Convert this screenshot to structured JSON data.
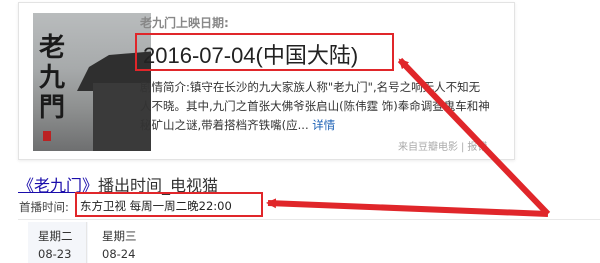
{
  "movie_card": {
    "poster_calligraphy": "老九門",
    "release_label": "老九门上映日期:",
    "release_value": "2016-07-04(中国大陆)",
    "synopsis": "剧情简介:镇守在长沙的九大家族人称\"老九门\",名号之响无人不知无人不晓。其中,九门之首张大佛爷张启山(陈伟霆 饰)奉命调查鬼车和神秘矿山之谜,带着搭档齐铁嘴(应...",
    "more_label": "详情",
    "source_text": "来自豆瓣电影",
    "report_label": "报错"
  },
  "result": {
    "title_part1": "《老九门》",
    "title_part2": "播出时间_电视猫"
  },
  "airtime": {
    "label": "首播时间:",
    "value": "东方卫视 每周一周二晚22:00"
  },
  "schedule": {
    "days": [
      {
        "name": "星期二",
        "date": "08-23"
      },
      {
        "name": "星期三",
        "date": "08-24"
      }
    ]
  },
  "colors": {
    "highlight_red": "#e0262a",
    "link_blue": "#1a0dab"
  }
}
